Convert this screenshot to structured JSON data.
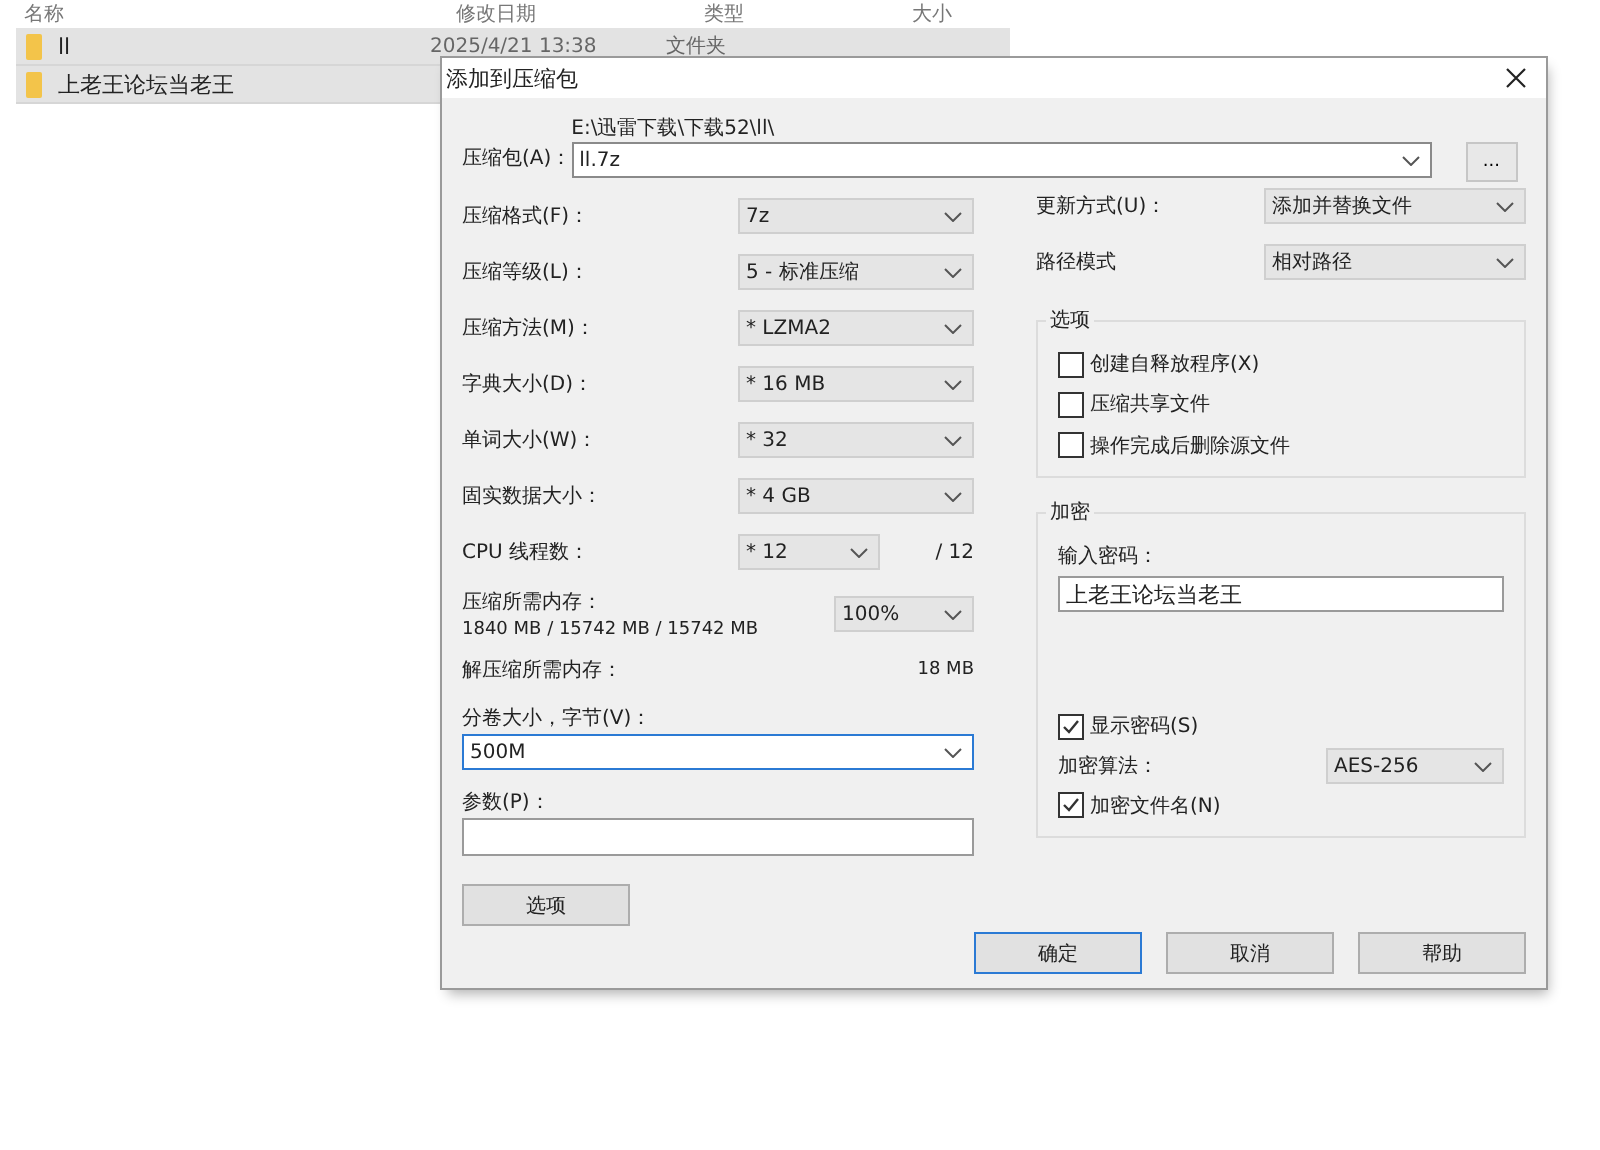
{
  "explorer": {
    "columns": [
      "名称",
      "修改日期",
      "类型",
      "大小"
    ],
    "rows": [
      {
        "name": "ll",
        "modified": "2025/4/21 13:38",
        "type": "文件夹",
        "selected": true
      },
      {
        "name": "上老王论坛当老王",
        "selected": true
      }
    ]
  },
  "dialog": {
    "title": "添加到压缩包",
    "archive": {
      "label": "压缩包(A)：",
      "path": "E:\\迅雷下载\\下载52\\ll\\",
      "value": "ll.7z",
      "browse": "..."
    },
    "left_fields": [
      {
        "kind": "combo",
        "label": "压缩格式(F)：",
        "value": "7z"
      },
      {
        "kind": "combo",
        "label": "压缩等级(L)：",
        "value": "5 - 标准压缩"
      },
      {
        "kind": "combo",
        "label": "压缩方法(M)：",
        "value": "* LZMA2"
      },
      {
        "kind": "combo",
        "label": "字典大小(D)：",
        "value": "* 16 MB"
      },
      {
        "kind": "combo",
        "label": "单词大小(W)：",
        "value": "* 32"
      },
      {
        "kind": "combo",
        "label": "固实数据大小：",
        "value": "* 4 GB"
      },
      {
        "kind": "threads",
        "label": "CPU 线程数：",
        "value": "* 12",
        "total": "/ 12"
      },
      {
        "kind": "memory",
        "label": "压缩所需内存：",
        "detail": "1840 MB / 15742 MB / 15742 MB",
        "value": "100%"
      },
      {
        "kind": "info",
        "label": "解压缩所需内存：",
        "value": "18 MB"
      }
    ],
    "volume": {
      "label": "分卷大小，字节(V)：",
      "value": "500M"
    },
    "params": {
      "label": "参数(P)："
    },
    "options_button": "选项",
    "update_mode": {
      "label": "更新方式(U)：",
      "value": "添加并替换文件"
    },
    "path_mode": {
      "label": "路径模式",
      "value": "相对路径"
    },
    "options": {
      "title": "选项",
      "items": [
        {
          "label": "创建自释放程序(X)",
          "checked": false
        },
        {
          "label": "压缩共享文件",
          "checked": false
        },
        {
          "label": "操作完成后删除源文件",
          "checked": false
        }
      ]
    },
    "encryption": {
      "title": "加密",
      "password_label": "输入密码：",
      "password": "上老王论坛当老王",
      "show_password": {
        "label": "显示密码(S)",
        "checked": true
      },
      "method_label": "加密算法：",
      "method": "AES-256",
      "encrypt_names": {
        "label": "加密文件名(N)",
        "checked": true
      }
    },
    "buttons": [
      {
        "label": "确定",
        "default": true
      },
      {
        "label": "取消",
        "default": false
      },
      {
        "label": "帮助",
        "default": false
      }
    ]
  }
}
